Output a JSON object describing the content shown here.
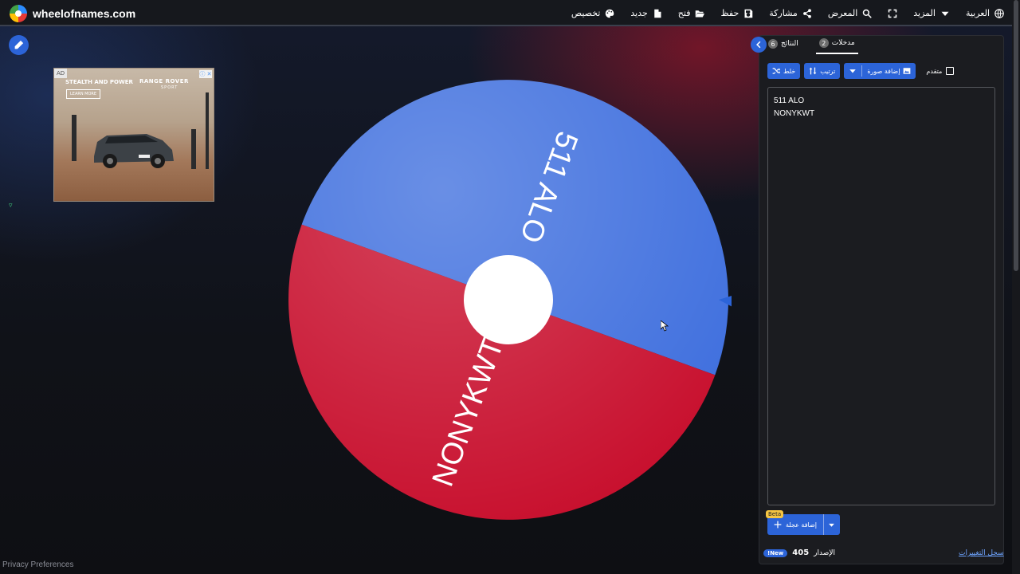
{
  "brand": {
    "name": "wheelofnames.com"
  },
  "menu": [
    {
      "label": "العربية",
      "icon": "globe-icon"
    },
    {
      "label": "المزيد",
      "icon": "caret-down-icon"
    },
    {
      "label": "",
      "icon": "fullscreen-icon"
    },
    {
      "label": "المعرض",
      "icon": "search-icon"
    },
    {
      "label": "مشاركة",
      "icon": "share-icon"
    },
    {
      "label": "حفظ",
      "icon": "save-icon"
    },
    {
      "label": "فتح",
      "icon": "folder-open-icon"
    },
    {
      "label": "جديد",
      "icon": "file-icon"
    },
    {
      "label": "تخصيص",
      "icon": "palette-icon"
    }
  ],
  "ad": {
    "badge": "AD",
    "headline": "STEALTH AND POWER",
    "brand": "RANGE ROVER",
    "brand_sub": "SPORT",
    "cta": "LEARN MORE",
    "close": "ⓘ ✕"
  },
  "wheel": {
    "segments": [
      {
        "label": "511 ALO",
        "color": "#3f6fde"
      },
      {
        "label": "NONYKWT",
        "color": "#c8102e"
      }
    ],
    "center_color": "#ffffff",
    "pointer_color": "#2c64d8"
  },
  "panel": {
    "tabs": [
      {
        "label": "مدخلات",
        "count": "2",
        "active": true
      },
      {
        "label": "النتائج",
        "count": "6",
        "active": false
      }
    ],
    "toolbar": {
      "shuffle": "خلط",
      "sort": "ترتيب",
      "add_image": "إضافة صورة",
      "advanced": "متقدم"
    },
    "entries": [
      "511 ALO",
      "NONYKWT"
    ],
    "add_wheel": "إضافة عجلة",
    "beta": "Beta",
    "version_label": "الإصدار",
    "version_number": "405",
    "new_badge": "New!",
    "changelog": "سجل التغييرات"
  },
  "footer": {
    "privacy": "Privacy Preferences"
  },
  "colors": {
    "accent": "#2c64d8",
    "segment_blue": "#3f6fde",
    "segment_red": "#c8102e"
  }
}
